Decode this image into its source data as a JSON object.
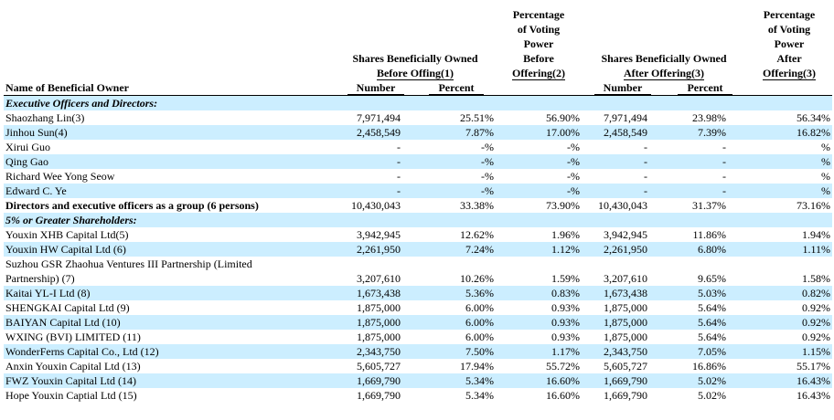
{
  "headers": {
    "name": "Name of Beneficial Owner",
    "before_group": [
      "Shares Beneficially Owned",
      "Before Offing(1)"
    ],
    "voting_before": [
      "Percentage",
      "of Voting",
      "Power",
      "Before",
      "Offering(2)"
    ],
    "after_group": [
      "Shares Beneficially Owned",
      "After Offering(3)"
    ],
    "voting_after": [
      "Percentage",
      "of Voting",
      "Power",
      "After",
      "Offering(3)"
    ],
    "number": "Number",
    "percent": "Percent"
  },
  "sections": {
    "officers": "Executive Officers and Directors:",
    "shareholders": "5% or Greater Shareholders:"
  },
  "officers": [
    [
      "Shaozhang Lin(3)",
      "7,971,494",
      "25.51%",
      "56.90%",
      "7,971,494",
      "23.98%",
      "56.34%"
    ],
    [
      "Jinhou Sun(4)",
      "2,458,549",
      "7.87%",
      "17.00%",
      "2,458,549",
      "7.39%",
      "16.82%"
    ],
    [
      "Xirui Guo",
      "-",
      "-%",
      "-%",
      "-",
      "-",
      "%"
    ],
    [
      "Qing Gao",
      "-",
      "-%",
      "-%",
      "-",
      "-",
      "%"
    ],
    [
      "Richard Wee Yong Seow",
      "-",
      "-%",
      "-%",
      "-",
      "-",
      "%"
    ],
    [
      "Edward C. Ye",
      "-",
      "-%",
      "-%",
      "-",
      "-",
      "%"
    ]
  ],
  "group_total": [
    "Directors and executive officers as a group (6 persons)",
    "10,430,043",
    "33.38%",
    "73.90%",
    "10,430,043",
    "31.37%",
    "73.16%"
  ],
  "shareholders": [
    [
      "Youxin XHB Capital Ltd(5)",
      "3,942,945",
      "12.62%",
      "1.96%",
      "3,942,945",
      "11.86%",
      "1.94%"
    ],
    [
      "Youxin HW Capital Ltd (6)",
      "2,261,950",
      "7.24%",
      "1.12%",
      "2,261,950",
      "6.80%",
      "1.11%"
    ],
    [
      "Kaitai YL-I Ltd (8)",
      "1,673,438",
      "5.36%",
      "0.83%",
      "1,673,438",
      "5.03%",
      "0.82%"
    ],
    [
      "SHENGKAI Capital Ltd (9)",
      "1,875,000",
      "6.00%",
      "0.93%",
      "1,875,000",
      "5.64%",
      "0.92%"
    ],
    [
      "BAIYAN Capital Ltd (10)",
      "1,875,000",
      "6.00%",
      "0.93%",
      "1,875,000",
      "5.64%",
      "0.92%"
    ],
    [
      "WXING (BVI) LIMITED (11)",
      "1,875,000",
      "6.00%",
      "0.93%",
      "1,875,000",
      "5.64%",
      "0.92%"
    ],
    [
      "WonderFerns Capital Co., Ltd (12)",
      "2,343,750",
      "7.50%",
      "1.17%",
      "2,343,750",
      "7.05%",
      "1.15%"
    ],
    [
      "Anxin Youxin Capital Ltd (13)",
      "5,605,727",
      "17.94%",
      "55.72%",
      "5,605,727",
      "16.86%",
      "55.17%"
    ],
    [
      "FWZ Youxin Capital Ltd (14)",
      "1,669,790",
      "5.34%",
      "16.60%",
      "1,669,790",
      "5.02%",
      "16.43%"
    ],
    [
      "Hope Youxin Captial Ltd (15)",
      "1,669,790",
      "5.34%",
      "16.60%",
      "1,669,790",
      "5.02%",
      "16.43%"
    ]
  ],
  "suzhou": {
    "line1": "Suzhou GSR Zhaohua Ventures III Partnership (Limited",
    "line2": "Partnership) (7)",
    "values": [
      "3,207,610",
      "10.26%",
      "1.59%",
      "3,207,610",
      "9.65%",
      "1.58%"
    ]
  },
  "colors": {
    "shade": "#cceeff"
  }
}
